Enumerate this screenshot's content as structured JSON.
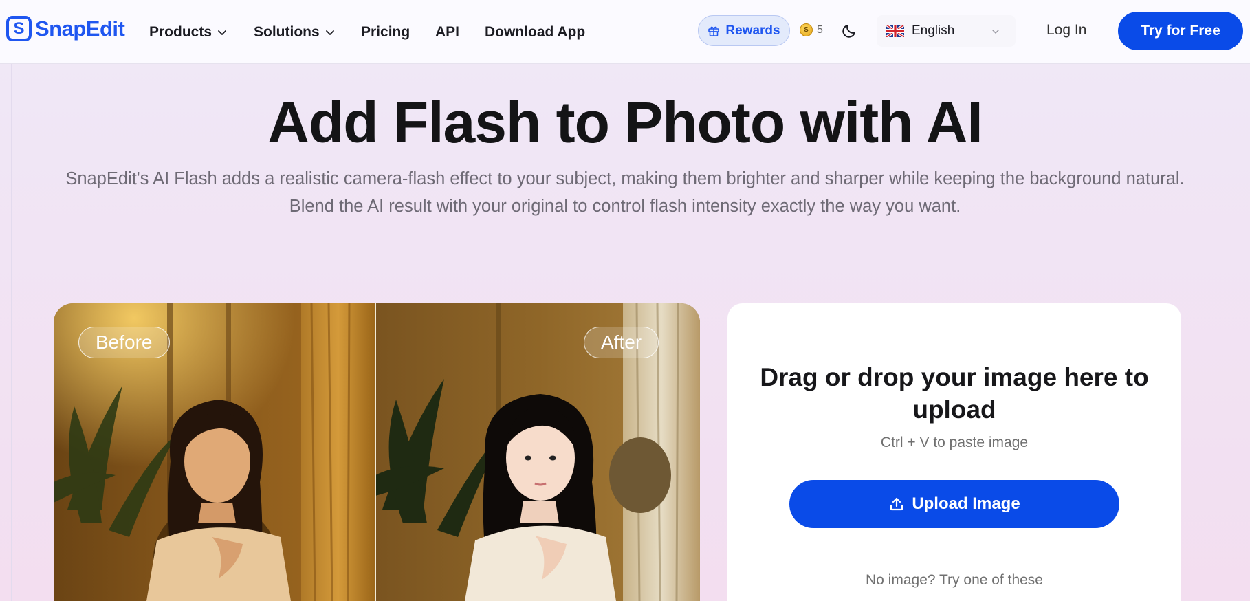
{
  "header": {
    "brand": "SnapEdit",
    "nav": {
      "products": "Products",
      "solutions": "Solutions",
      "pricing": "Pricing",
      "api": "API",
      "download": "Download App"
    },
    "rewards_label": "Rewards",
    "coins": "5",
    "language": "English",
    "login_label": "Log In",
    "try_label": "Try for Free"
  },
  "hero": {
    "title": "Add Flash to Photo with AI",
    "subtitle": "SnapEdit's AI Flash adds a realistic camera-flash effect to your subject, making them brighter and sharper while keeping the background natural. Blend the AI result with your original to control flash intensity exactly the way you want."
  },
  "compare": {
    "before_label": "Before",
    "after_label": "After"
  },
  "upload": {
    "title": "Drag or drop your image here to upload",
    "paste_hint": "Ctrl + V to paste image",
    "button_label": "Upload Image",
    "samples_label": "No image? Try one of these"
  },
  "colors": {
    "brand": "#1f56f0",
    "primary_button": "#0a4be8"
  }
}
